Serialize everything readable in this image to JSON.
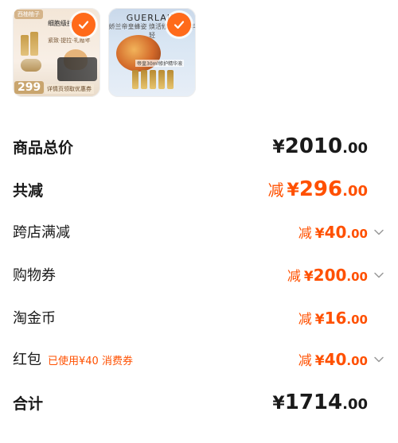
{
  "thumbnails": [
    {
      "tag": "西柚柚子",
      "headline": "细胞级抗皱",
      "sub": "紧致·提拉·礼赠年",
      "price": "299",
      "promo": "详情页领取优惠券"
    },
    {
      "brand": "GUERLAIN",
      "subtext": "娇兰帝皇蜂姿 焕活修护 紧致年轻",
      "caption": "帝皇30ml修护精华液"
    }
  ],
  "summary": {
    "subtotal": {
      "label": "商品总价",
      "yen": "¥",
      "int": "2010",
      "dec": ".00"
    },
    "discount_total": {
      "label": "共减",
      "prefix": "减",
      "yen": "¥",
      "int": "296",
      "dec": ".00"
    },
    "cross_store": {
      "label": "跨店满减",
      "prefix": "减",
      "yen": "¥",
      "int": "40",
      "dec": ".00"
    },
    "shopping_voucher": {
      "label": "购物券",
      "prefix": "减",
      "yen": "¥",
      "int": "200",
      "dec": ".00"
    },
    "taojinbi": {
      "label": "淘金币",
      "prefix": "减",
      "yen": "¥",
      "int": "16",
      "dec": ".00"
    },
    "red_packet": {
      "label": "红包",
      "note": "已使用¥40 消费券",
      "prefix": "减",
      "yen": "¥",
      "int": "40",
      "dec": ".00"
    },
    "total": {
      "label": "合计",
      "yen": "¥",
      "int": "1714",
      "dec": ".00"
    }
  },
  "colors": {
    "accent": "#ff5000",
    "check": "#ff6a1a",
    "text": "#1a1a1a"
  },
  "icons": {
    "selected": "check-circle-icon",
    "expand": "chevron-down-icon"
  }
}
